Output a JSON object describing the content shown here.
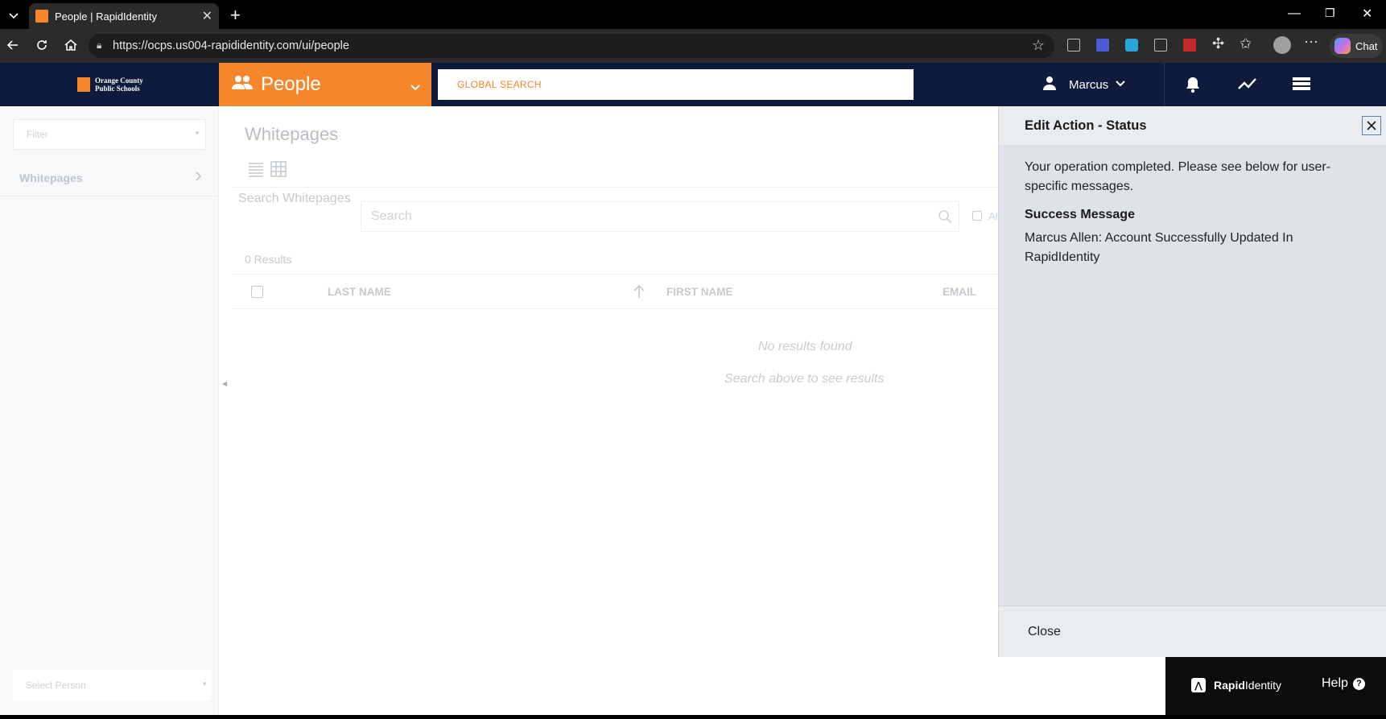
{
  "browser": {
    "tab_title": "People | RapidIdentity",
    "url": "https://ocps.us004-rapididentity.com/ui/people",
    "chat_label": "Chat"
  },
  "header": {
    "org_name_line1": "Orange County",
    "org_name_line2": "Public Schools",
    "app_title": "People",
    "global_search_placeholder": "GLOBAL SEARCH",
    "user_name": "Marcus"
  },
  "sidebar": {
    "filter_placeholder": "Filter",
    "items": [
      {
        "label": "Whitepages"
      }
    ],
    "select_person_placeholder": "Select Person"
  },
  "main": {
    "title": "Whitepages",
    "search_label": "Search Whitepages",
    "search_placeholder": "Search",
    "checkbox_label_fragment": "Al",
    "results_count": "0 Results",
    "columns": [
      "LAST NAME",
      "FIRST NAME",
      "EMAIL"
    ],
    "no_results": "No results found",
    "no_results_hint": "Search above to see results"
  },
  "panel": {
    "title": "Edit Action - Status",
    "message": "Your operation completed. Please see below for user-specific messages.",
    "success_heading": "Success Message",
    "success_text": "Marcus Allen: Account Successfully Updated In RapidIdentity",
    "close_label": "Close"
  },
  "footer": {
    "brand_bold": "Rapid",
    "brand_light": "Identity",
    "help_label": "Help"
  },
  "colors": {
    "accent_orange": "#f4862b",
    "navy": "#0f1b3c",
    "panel_bg": "#dfe3e7"
  }
}
